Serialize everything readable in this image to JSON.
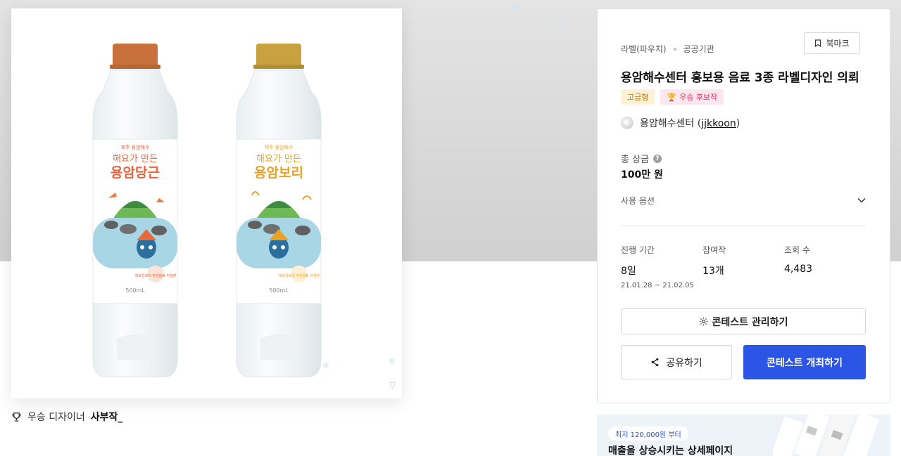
{
  "artwork": {
    "bottles": [
      {
        "top_text": "제주 용암해수",
        "script_text": "해요가 만든",
        "name": "용암당근",
        "badge_text": "제로칼로리 자연음료 저열량",
        "volume": "500mL",
        "cap_color": "#c8713f",
        "name_color": "#e8643c"
      },
      {
        "top_text": "제주 용암해수",
        "script_text": "해요가 만든",
        "name": "용암보리",
        "badge_text": "제로칼로리 자연음료 저열량",
        "volume": "500mL",
        "cap_color": "#c7a23e",
        "name_color": "#e8a327"
      }
    ],
    "corner_glyph": "▽"
  },
  "designer": {
    "icon": "trophy-icon",
    "prefix": "우승 디자이너",
    "name": "사부작_"
  },
  "contest": {
    "category": "라벨(파우치)",
    "host_type": "공공기관",
    "bookmark_label": "북마크",
    "title": "용암해수센터 홍보용 음료 3종 라벨디자인 의뢰",
    "badges": {
      "premium": "고급형",
      "award": "우승 후보작"
    },
    "host": {
      "name": "용암해수센터",
      "id": "jjkkoon"
    },
    "prize_label": "총 상금",
    "prize_value": "100만 원",
    "usage_label": "사용 옵션",
    "stats": {
      "period_label": "진행 기간",
      "period_value": "8일",
      "period_range": "21.01.28 ~ 21.02.05",
      "entries_label": "참여작",
      "entries_value": "13개",
      "views_label": "조회 수",
      "views_value": "4,483"
    },
    "manage_label": "콘테스트 관리하기",
    "share_label": "공유하기",
    "open_label": "콘테스트 개최하기"
  },
  "ad": {
    "pill": "최저 120,000원 부터",
    "headline": "매출을 상승시키는 상세페이지"
  },
  "colors": {
    "primary": "#2a55e5",
    "premium_bg": "#fff1d6",
    "premium_text": "#c07800",
    "award_bg": "#fde6ee",
    "award_text": "#d63869"
  }
}
